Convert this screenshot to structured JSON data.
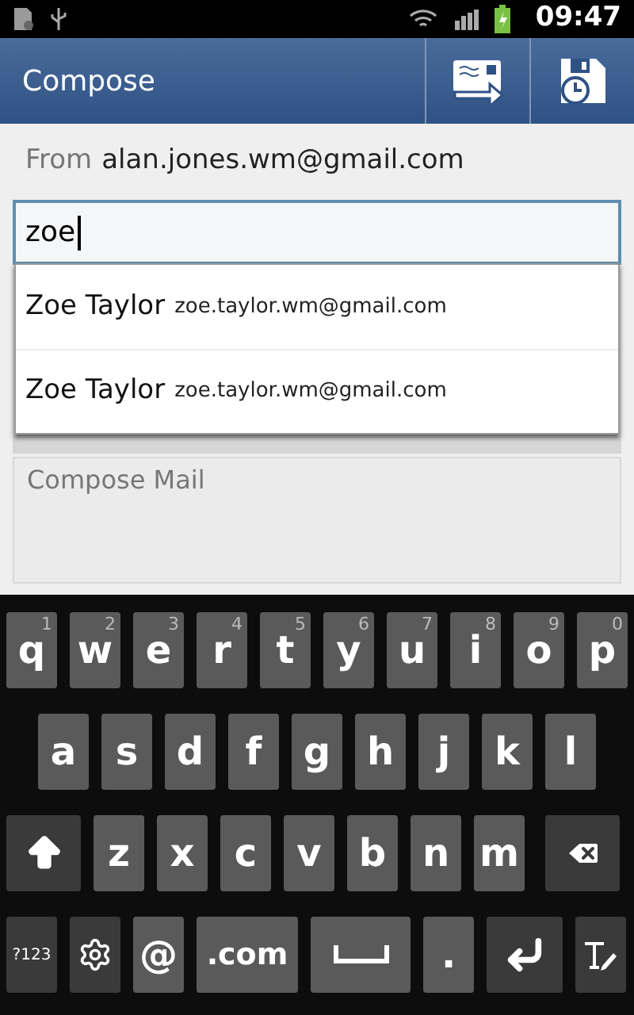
{
  "status_bar": {
    "time": "09:47"
  },
  "header": {
    "title": "Compose"
  },
  "from": {
    "label": "From",
    "address": "alan.jones.wm@gmail.com"
  },
  "to_field": {
    "value": "zoe"
  },
  "suggestions": [
    {
      "name": "Zoe Taylor",
      "email": "zoe.taylor.wm@gmail.com"
    },
    {
      "name": "Zoe Taylor",
      "email": "zoe.taylor.wm@gmail.com"
    }
  ],
  "body": {
    "placeholder": "Compose Mail"
  },
  "keyboard": [
    [
      {
        "kind": "char",
        "label": "q",
        "hint": "1"
      },
      {
        "kind": "char",
        "label": "w",
        "hint": "2"
      },
      {
        "kind": "char",
        "label": "e",
        "hint": "3"
      },
      {
        "kind": "char",
        "label": "r",
        "hint": "4"
      },
      {
        "kind": "char",
        "label": "t",
        "hint": "5"
      },
      {
        "kind": "char",
        "label": "y",
        "hint": "6"
      },
      {
        "kind": "char",
        "label": "u",
        "hint": "7"
      },
      {
        "kind": "char",
        "label": "i",
        "hint": "8"
      },
      {
        "kind": "char",
        "label": "o",
        "hint": "9"
      },
      {
        "kind": "char",
        "label": "p",
        "hint": "0"
      }
    ],
    [
      {
        "kind": "char",
        "label": "a"
      },
      {
        "kind": "char",
        "label": "s"
      },
      {
        "kind": "char",
        "label": "d"
      },
      {
        "kind": "char",
        "label": "f"
      },
      {
        "kind": "char",
        "label": "g"
      },
      {
        "kind": "char",
        "label": "h"
      },
      {
        "kind": "char",
        "label": "j"
      },
      {
        "kind": "char",
        "label": "k"
      },
      {
        "kind": "char",
        "label": "l"
      }
    ],
    [
      {
        "kind": "shift"
      },
      {
        "kind": "char",
        "label": "z"
      },
      {
        "kind": "char",
        "label": "x"
      },
      {
        "kind": "char",
        "label": "c"
      },
      {
        "kind": "char",
        "label": "v"
      },
      {
        "kind": "char",
        "label": "b"
      },
      {
        "kind": "char",
        "label": "n"
      },
      {
        "kind": "char",
        "label": "m"
      },
      {
        "kind": "backspace"
      }
    ],
    [
      {
        "kind": "symbols",
        "label": "?123"
      },
      {
        "kind": "settings"
      },
      {
        "kind": "char",
        "label": "@"
      },
      {
        "kind": "wide",
        "label": ".com"
      },
      {
        "kind": "space"
      },
      {
        "kind": "char",
        "label": "."
      },
      {
        "kind": "enter"
      },
      {
        "kind": "handwriting"
      }
    ]
  ]
}
